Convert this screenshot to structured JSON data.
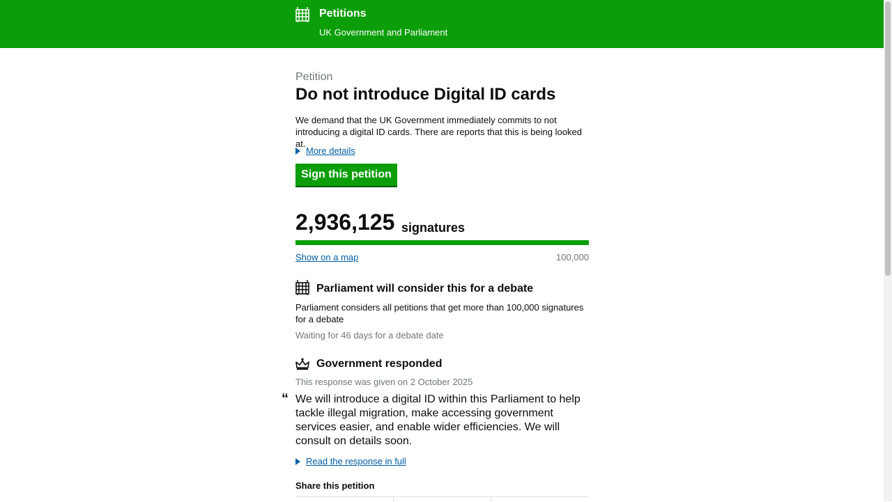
{
  "header": {
    "title": "Petitions",
    "subtitle": "UK Government and Parliament",
    "icon": "portcullis-icon"
  },
  "petition": {
    "eyebrow": "Petition",
    "title": "Do not introduce Digital ID cards",
    "description": "We demand that the UK Government immediately commits to not introducing a digital ID cards. There are reports that this is being looked at.",
    "more_details": "More details",
    "sign_button": "Sign this petition"
  },
  "signatures": {
    "count": "2,936,125",
    "label": "signatures",
    "progress_fraction": 1.0,
    "map_link": "Show on a map",
    "threshold": "100,000"
  },
  "debate": {
    "icon": "portcullis-icon",
    "heading": "Parliament will consider this for a debate",
    "text": "Parliament considers all petitions that get more than 100,000 signatures for a debate",
    "status": "Waiting for 46 days for a debate date"
  },
  "government": {
    "icon": "crown-icon",
    "heading": "Government responded",
    "date": "This response was given on 2 October 2025",
    "quote_mark": "“",
    "quote": "We will introduce a digital ID within this Parliament to help tackle illegal migration, make accessing government services easier, and enable wider efficiencies. We will consult on details soon.",
    "read_full": "Read the response in full"
  },
  "share": {
    "heading": "Share this petition"
  },
  "colors": {
    "brand_green": "#0b9e09",
    "link_blue": "#005ea5",
    "secondary_text": "#6f777b"
  }
}
